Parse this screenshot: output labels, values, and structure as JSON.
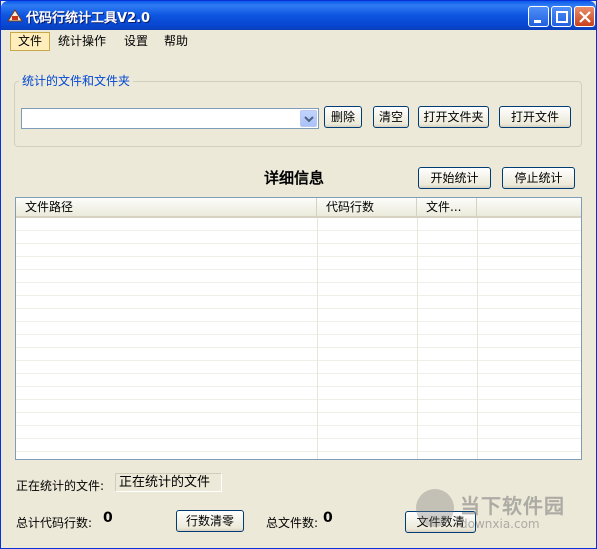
{
  "window": {
    "title": "代码行统计工具V2.0"
  },
  "menu": {
    "items": [
      "文件",
      "统计操作",
      "设置",
      "帮助"
    ]
  },
  "group": {
    "title": "统计的文件和文件夹",
    "combo_value": "",
    "buttons": {
      "delete": "删除",
      "clear": "清空",
      "open_folder": "打开文件夹",
      "open_file": "打开文件"
    }
  },
  "detail": {
    "title": "详细信息",
    "start": "开始统计",
    "stop": "停止统计"
  },
  "list": {
    "columns": [
      "文件路径",
      "代码行数",
      "文件..."
    ],
    "rows": []
  },
  "footer": {
    "current_label": "正在统计的文件:",
    "current_value": "正在统计的文件",
    "total_lines_label": "总计代码行数:",
    "total_lines": "0",
    "reset_button": "行数清零",
    "total_files_label": "总文件数:",
    "total_files": "0",
    "clear_files_button": "文件数清"
  },
  "watermark": {
    "text": "当下软件园",
    "url": "downxia.com"
  },
  "colors": {
    "titlebar": "#0a55e0",
    "accent_blue": "#0046d5",
    "face": "#ece9d8"
  }
}
